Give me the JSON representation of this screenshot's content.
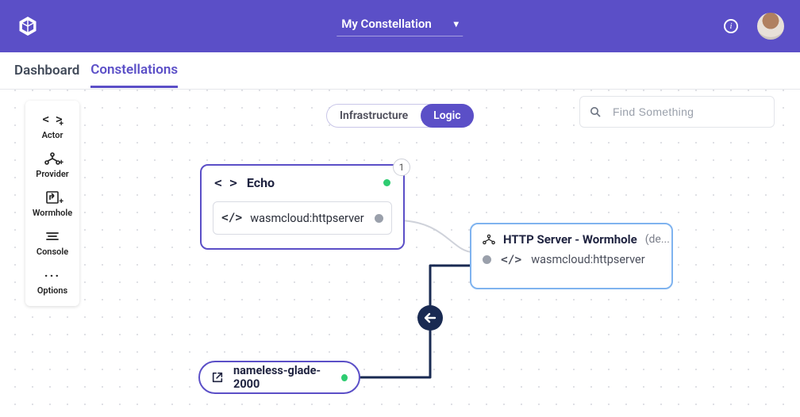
{
  "header": {
    "constellation_label": "My Constellation"
  },
  "tabs": {
    "dashboard": "Dashboard",
    "constellations": "Constellations"
  },
  "palette": {
    "actor": "Actor",
    "provider": "Provider",
    "wormhole": "Wormhole",
    "console": "Console",
    "options": "Options"
  },
  "mode": {
    "infrastructure": "Infrastructure",
    "logic": "Logic"
  },
  "search": {
    "placeholder": "Find Something"
  },
  "nodes": {
    "echo": {
      "title": "Echo",
      "contract": "wasmcloud:httpserver",
      "instance_count": "1"
    },
    "http": {
      "title": "HTTP Server - Wormhole",
      "detail": "(de...",
      "contract": "wasmcloud:httpserver"
    },
    "target": {
      "name": "nameless-glade-2000"
    }
  }
}
